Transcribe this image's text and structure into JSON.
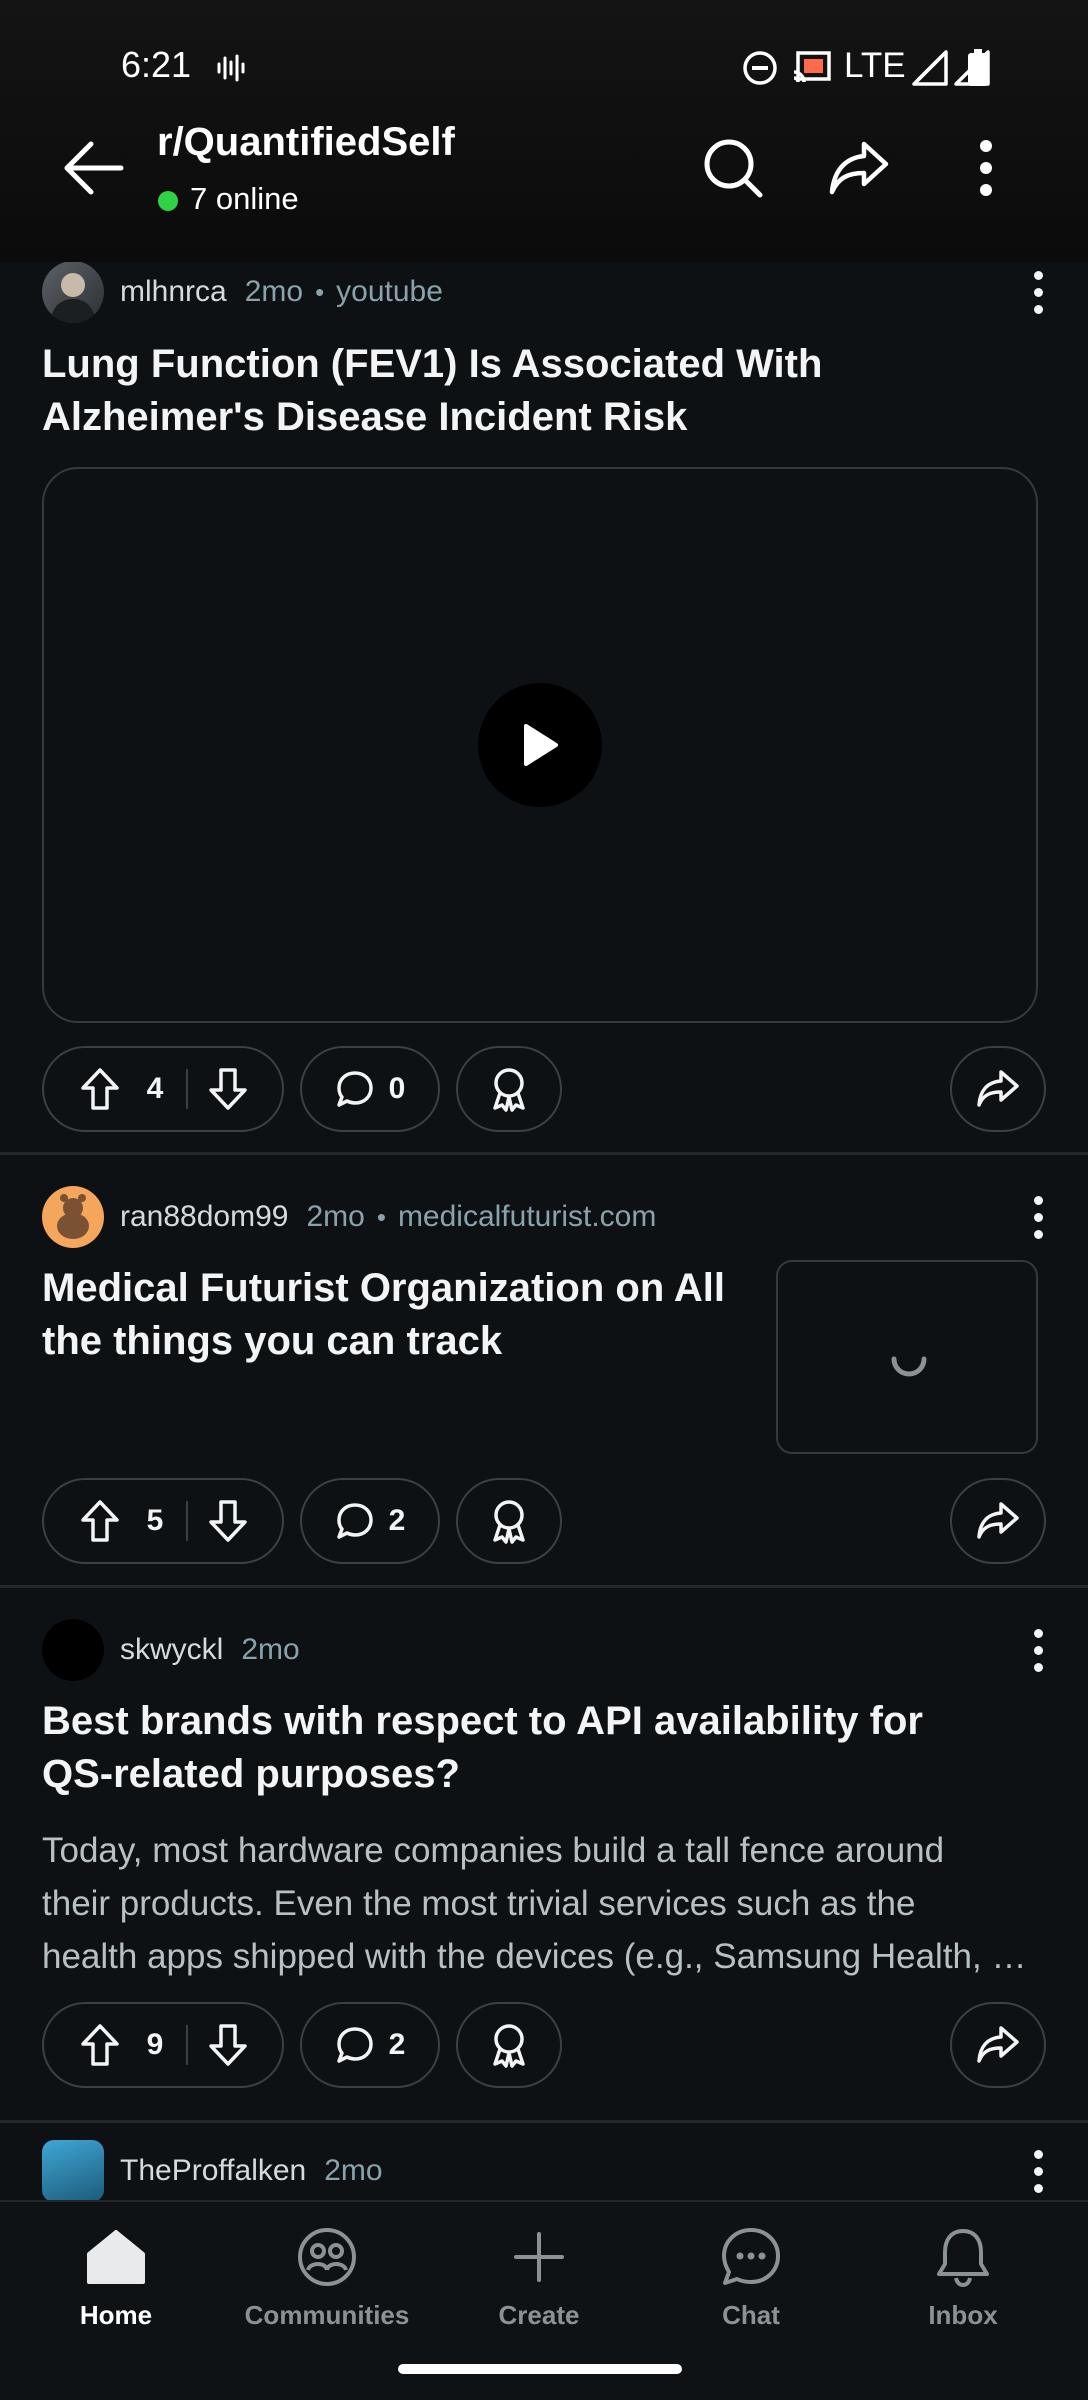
{
  "status_bar": {
    "time": "6:21",
    "network": "LTE",
    "icons": [
      "voice-wave-icon",
      "do-not-disturb-icon",
      "cast-icon",
      "signal-icon",
      "cell-signal-icon",
      "battery-icon"
    ]
  },
  "header": {
    "subreddit": "r/QuantifiedSelf",
    "online": "7 online",
    "online_color": "#2fd145",
    "buttons": [
      "back-arrow-icon",
      "search-icon",
      "share-icon",
      "more-vertical-icon"
    ]
  },
  "posts": [
    {
      "author": "mlhnrca",
      "age": "2mo",
      "source": "youtube",
      "title_line1": "Lung Function (FEV1) Is Associated With",
      "title_line2": "Alzheimer's Disease Incident Risk",
      "media": "video",
      "upvotes": "4",
      "comments": "0"
    },
    {
      "author": "ran88dom99",
      "age": "2mo",
      "source": "medicalfuturist.com",
      "title_line1": "Medical Futurist Organization on All",
      "title_line2": "the things you can track",
      "media": "link-thumbnail-loading",
      "upvotes": "5",
      "comments": "2"
    },
    {
      "author": "skwyckl",
      "age": "2mo",
      "title_line1": "Best brands with respect to API availability for",
      "title_line2": "QS-related purposes?",
      "body_line1": "Today, most hardware companies build a tall fence around",
      "body_line2": "their products. Even the most trivial services such as the",
      "body_line3": "health apps shipped with the devices (e.g., Samsung Health, …",
      "upvotes": "9",
      "comments": "2"
    },
    {
      "author": "TheProffalken",
      "age": "2mo"
    }
  ],
  "bottom_nav": {
    "items": [
      {
        "label": "Home",
        "icon": "home-icon",
        "active": true
      },
      {
        "label": "Communities",
        "icon": "communities-icon",
        "active": false
      },
      {
        "label": "Create",
        "icon": "plus-icon",
        "active": false
      },
      {
        "label": "Chat",
        "icon": "chat-icon",
        "active": false
      },
      {
        "label": "Inbox",
        "icon": "bell-icon",
        "active": false
      }
    ]
  },
  "colors": {
    "background": "#0e1113",
    "text_primary": "#f2f4f5",
    "text_meta": "#8ba2ad",
    "border": "#3a4044"
  }
}
